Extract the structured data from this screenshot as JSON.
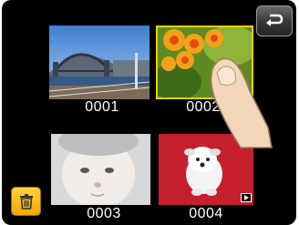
{
  "navigation": {
    "back_icon": "return-arrow-icon"
  },
  "gallery": {
    "items": [
      {
        "label": "0001",
        "subject": "harbour-bridge-photo"
      },
      {
        "label": "0002",
        "subject": "flowers-photo",
        "selected": true
      },
      {
        "label": "0003",
        "subject": "baby-photo"
      },
      {
        "label": "0004",
        "subject": "puppy-photo",
        "video": true
      }
    ]
  },
  "toolbar": {
    "delete_icon": "trash-icon"
  },
  "colors": {
    "background": "#000000",
    "selection_border": "#e9d100",
    "trash_button": "#f7b800",
    "video_tile": "#c61f2e"
  }
}
